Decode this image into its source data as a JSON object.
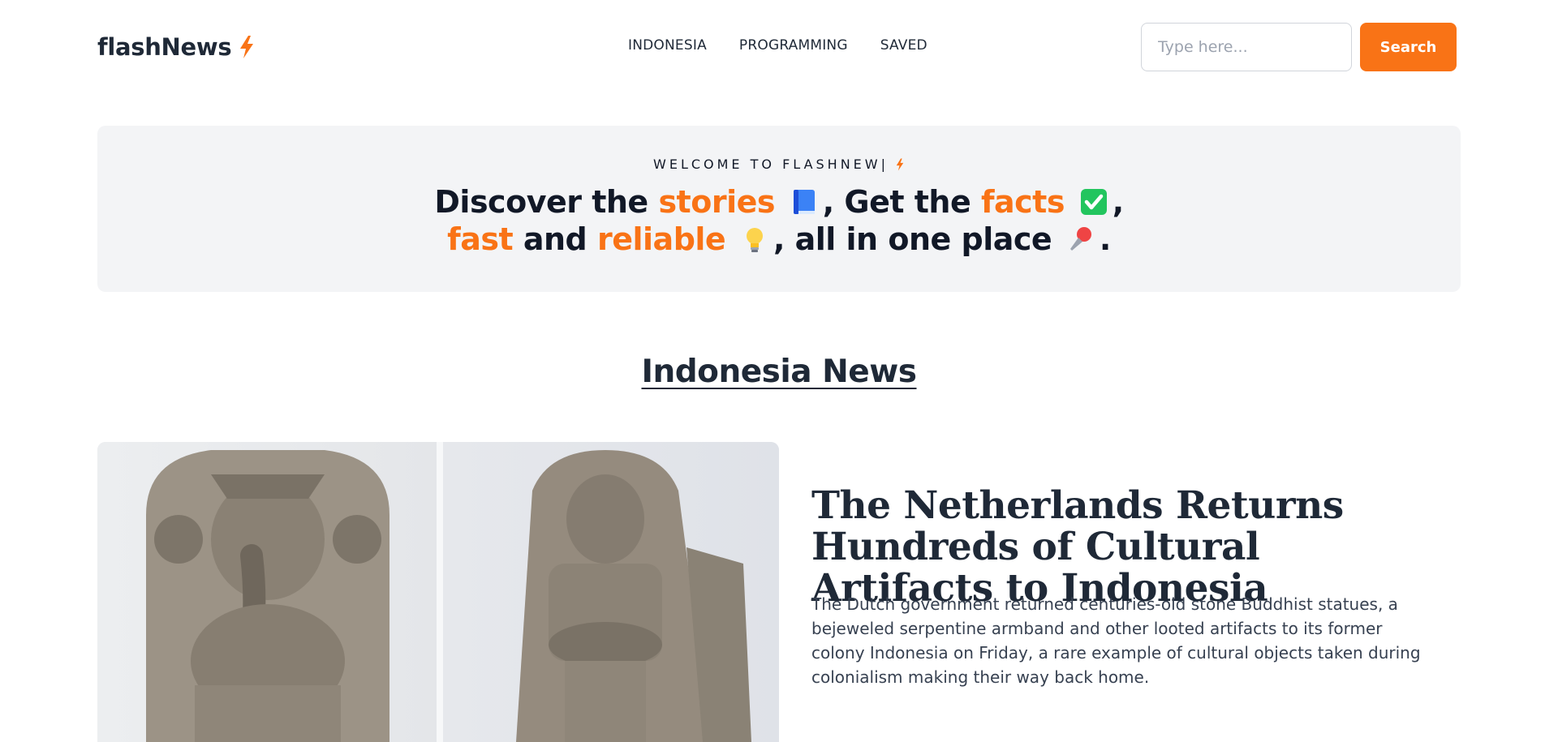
{
  "header": {
    "brand": "flashNews",
    "nav": [
      "INDONESIA",
      "PROGRAMMING",
      "SAVED"
    ],
    "search": {
      "placeholder": "Type here...",
      "button_label": "Search"
    }
  },
  "hero": {
    "eyebrow": "WELCOME TO FLASHNEW|",
    "line1": {
      "part1": "Discover the ",
      "accent1": "stories",
      "emoji1": "blue-book-emoji",
      "part2": ", Get the ",
      "accent2": "facts",
      "emoji2": "check-mark-emoji",
      "part3": ","
    },
    "line2": {
      "accent1": "fast",
      "part1": " and ",
      "accent2": "reliable",
      "emoji1": "light-bulb-emoji",
      "part2": ", all in one place",
      "emoji2": "pushpin-emoji",
      "part3": "."
    }
  },
  "section": {
    "title": "Indonesia News"
  },
  "article": {
    "title": "The Netherlands Returns Hundreds of Cultural Artifacts to Indonesia",
    "summary": "The Dutch government returned centuries-old stone Buddhist statues, a bejeweled serpentine armband and other looted artifacts to its former colony Indonesia on Friday, a rare example of cultural objects taken during colonialism making their way back home.",
    "image_alt": "Stone statues of Ganesha and a Hindu deity"
  },
  "colors": {
    "accent": "#f97316",
    "text": "#1f2937",
    "hero_bg": "#f3f4f6"
  }
}
